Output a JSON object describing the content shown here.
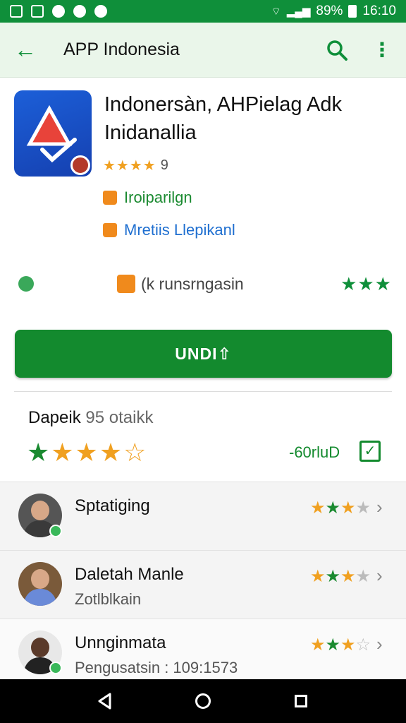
{
  "status_bar": {
    "battery": "89%",
    "time": "16:10",
    "icons": [
      "notification-icon",
      "notification-icon",
      "notification-icon",
      "notification-icon",
      "notification-icon",
      "wifi-icon",
      "signal-icon",
      "battery-icon"
    ]
  },
  "app_bar": {
    "back_icon": "arrow-back-icon",
    "title": "APP Indonesia",
    "search_icon": "search-icon",
    "more_icon": "more-vert-icon"
  },
  "app": {
    "name_line1": "Indonersàn, AHPielag Adk",
    "name_line2": "Inidanallia",
    "rating_stars": "★★★★",
    "rating_value": "9",
    "meta1": "Iroiparilgn",
    "meta2": "Mretiis Llepikanl",
    "info_text": "(k runsrngasin",
    "info_rating": "★★★"
  },
  "install_button": "UNDI⇧",
  "ratings_summary": {
    "label": "Dapeik",
    "count_text": "95 otaikk",
    "stars": "★★★★☆",
    "total": "-60rluD"
  },
  "reviews": [
    {
      "name": "Sptatiging",
      "subtitle": "",
      "stars_full": "★★★",
      "stars_empty": "★"
    },
    {
      "name": "Daletah Manle",
      "subtitle": "Zotlblkain",
      "stars_full": "★★★",
      "stars_empty": "★"
    },
    {
      "name": "Unnginmata",
      "subtitle": "Pengusatsin : 109:1573",
      "stars_full": "★★★",
      "stars_empty": "☆"
    }
  ],
  "colors": {
    "primary": "#138a2e",
    "appbar_bg": "#eaf6ea",
    "star": "#f0a020",
    "icon_bg": "#1c5fd8"
  }
}
